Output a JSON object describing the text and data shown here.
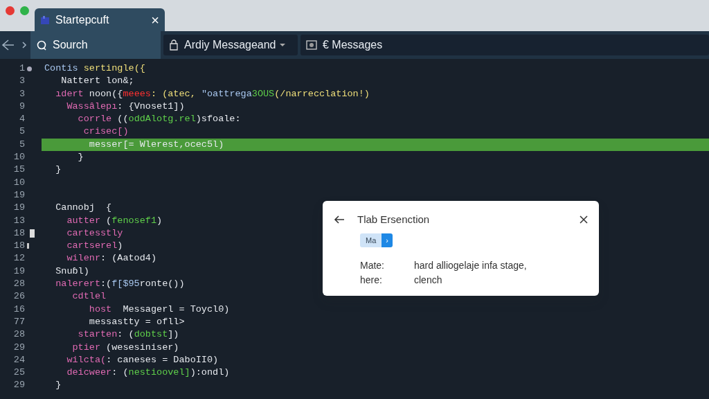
{
  "window": {
    "title": "Startepcuft",
    "close": "×"
  },
  "toolbar": {
    "search": {
      "label": "Sourch"
    },
    "dropdown": {
      "label": "Ardiy Messageand"
    },
    "messages": {
      "label": "€ Messages"
    }
  },
  "editor": {
    "lines": [
      {
        "number": "1",
        "marker": {
          "kind": "dot"
        },
        "highlighted": false,
        "tokens": [
          {
            "text": "Contis ",
            "kind": "type"
          },
          {
            "text": "sertingle({",
            "kind": "func"
          }
        ]
      },
      {
        "number": "3",
        "highlighted": false,
        "tokens": [
          {
            "text": "   Nattert lon&;",
            "kind": "plain"
          }
        ]
      },
      {
        "number": "3",
        "highlighted": false,
        "tokens": [
          {
            "text": "  ıdert",
            "kind": "keyword"
          },
          {
            "text": " noon({",
            "kind": "plain"
          },
          {
            "text": "meees",
            "kind": "error"
          },
          {
            "text": ": (atec, ",
            "kind": "func"
          },
          {
            "text": "\"oattrega",
            "kind": "type"
          },
          {
            "text": "3OUS",
            "kind": "string"
          },
          {
            "text": "(/narrecclation!)",
            "kind": "func"
          }
        ]
      },
      {
        "number": "9",
        "highlighted": false,
        "tokens": [
          {
            "text": "    Wassâlepı",
            "kind": "keyword"
          },
          {
            "text": ": {Vnoset1])",
            "kind": "plain"
          }
        ]
      },
      {
        "number": "4",
        "highlighted": false,
        "tokens": [
          {
            "text": "      corrle",
            "kind": "keyword"
          },
          {
            "text": " ((",
            "kind": "plain"
          },
          {
            "text": "oddAlotg.rel",
            "kind": "string"
          },
          {
            "text": ")sfoale:",
            "kind": "plain"
          }
        ]
      },
      {
        "number": "5",
        "highlighted": false,
        "tokens": [
          {
            "text": "       crisec[)",
            "kind": "keyword"
          }
        ]
      },
      {
        "number": "5",
        "highlighted": true,
        "tokens": [
          {
            "text": "        messer[= Wlerest,ocec5l)",
            "kind": "plain"
          }
        ]
      },
      {
        "number": "10",
        "highlighted": false,
        "tokens": [
          {
            "text": "      }",
            "kind": "plain"
          }
        ]
      },
      {
        "number": "15",
        "highlighted": false,
        "tokens": [
          {
            "text": "  }",
            "kind": "plain"
          }
        ]
      },
      {
        "number": "10",
        "highlighted": false
      },
      {
        "number": "19",
        "highlighted": false
      },
      {
        "number": "19",
        "highlighted": false,
        "tokens": [
          {
            "text": "  Cannobj  {",
            "kind": "plain"
          }
        ]
      },
      {
        "number": "13",
        "highlighted": false,
        "tokens": [
          {
            "text": "    autter",
            "kind": "keyword"
          },
          {
            "text": " (",
            "kind": "plain"
          },
          {
            "text": "fenosef1",
            "kind": "string"
          },
          {
            "text": ")",
            "kind": "plain"
          }
        ]
      },
      {
        "number": "18",
        "marker": {
          "kind": "block"
        },
        "highlighted": false,
        "tokens": [
          {
            "text": "    cartesstly",
            "kind": "keyword"
          }
        ]
      },
      {
        "number": "18",
        "marker": {
          "kind": "bar"
        },
        "highlighted": false,
        "tokens": [
          {
            "text": "    cartserel",
            "kind": "keyword"
          },
          {
            "text": ")",
            "kind": "plain"
          }
        ]
      },
      {
        "number": "12",
        "highlighted": false,
        "tokens": [
          {
            "text": "    wilenr",
            "kind": "keyword"
          },
          {
            "text": ": (Aatod4)",
            "kind": "plain"
          }
        ]
      },
      {
        "number": "19",
        "highlighted": false,
        "tokens": [
          {
            "text": "  Snuɓl)",
            "kind": "plain"
          }
        ]
      },
      {
        "number": "28",
        "highlighted": false,
        "tokens": [
          {
            "text": "  nalerert",
            "kind": "keyword"
          },
          {
            "text": ":(",
            "kind": "plain"
          },
          {
            "text": "f[$95",
            "kind": "type"
          },
          {
            "text": "ronte())",
            "kind": "plain"
          }
        ]
      },
      {
        "number": "26",
        "highlighted": false,
        "tokens": [
          {
            "text": "     cdtlel",
            "kind": "keyword"
          }
        ]
      },
      {
        "number": "16",
        "highlighted": false,
        "tokens": [
          {
            "text": "        host",
            "kind": "keyword"
          },
          {
            "text": "  Messagerl = Toycl0)",
            "kind": "plain"
          }
        ]
      },
      {
        "number": "77",
        "highlighted": false,
        "tokens": [
          {
            "text": "        messastty = ofll>",
            "kind": "plain"
          }
        ]
      },
      {
        "number": "28",
        "highlighted": false,
        "tokens": [
          {
            "text": "      starten",
            "kind": "keyword"
          },
          {
            "text": ": (",
            "kind": "plain"
          },
          {
            "text": "dobtst",
            "kind": "string"
          },
          {
            "text": "])",
            "kind": "plain"
          }
        ]
      },
      {
        "number": "29",
        "highlighted": false,
        "tokens": [
          {
            "text": "     ptier",
            "kind": "keyword"
          },
          {
            "text": " (wesesiniser)",
            "kind": "plain"
          }
        ]
      },
      {
        "number": "24",
        "highlighted": false,
        "tokens": [
          {
            "text": "    wilcta(",
            "kind": "keyword"
          },
          {
            "text": ": caneses = DaboII0)",
            "kind": "plain"
          }
        ]
      },
      {
        "number": "25",
        "highlighted": false,
        "tokens": [
          {
            "text": "    deicweer",
            "kind": "keyword"
          },
          {
            "text": ": (",
            "kind": "plain"
          },
          {
            "text": "nestioovel]",
            "kind": "string"
          },
          {
            "text": "):ondl)",
            "kind": "plain"
          }
        ]
      },
      {
        "number": "29",
        "highlighted": false,
        "tokens": [
          {
            "text": "  }",
            "kind": "plain"
          }
        ]
      }
    ]
  },
  "popup": {
    "title": "Tlab Ersenction",
    "tag": "Ma",
    "tag_button": "›",
    "rows": [
      {
        "label": "Mate:",
        "value": "hard alliogelaje infa stage,"
      },
      {
        "label": "here:",
        "value": "clench"
      }
    ]
  }
}
